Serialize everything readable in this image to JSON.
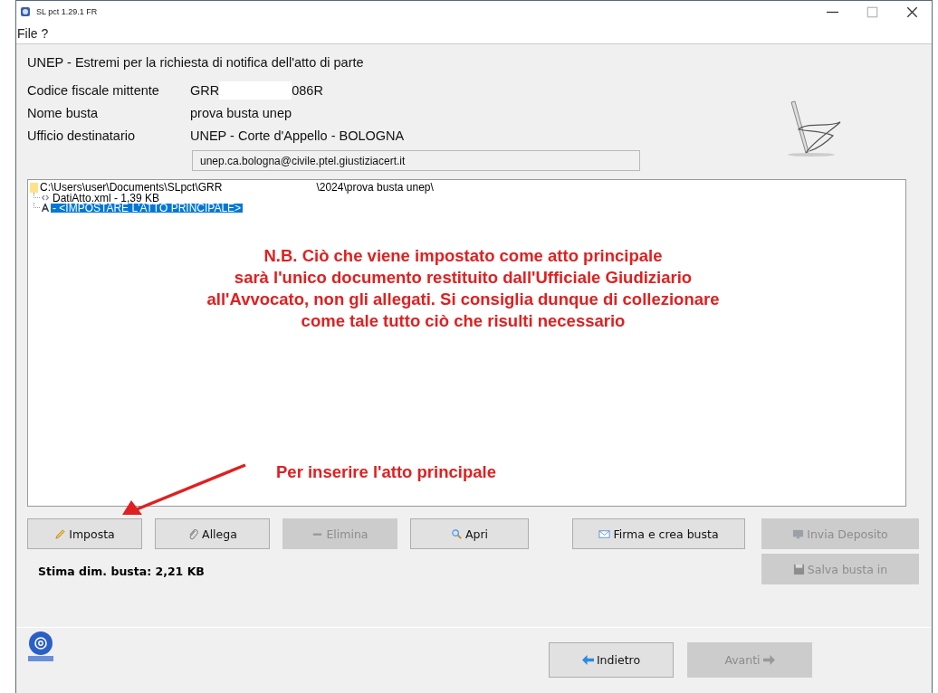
{
  "window": {
    "title": "SL pct 1.29.1 FR"
  },
  "menu": [
    "File",
    "?"
  ],
  "heading": "UNEP - Estremi per la richiesta di notifica dell'atto di parte",
  "fields": [
    {
      "label": "Codice fiscale mittente",
      "value_start": "GRR",
      "value_end": "086R"
    },
    {
      "label": "Nome busta",
      "value_start": "prova busta unep"
    },
    {
      "label": "Ufficio destinatario",
      "value_start": "UNEP - Corte d'Appello - BOLOGNA"
    }
  ],
  "email": {
    "value": "unep.ca.bologna@civile.ptel.giustiziacert.it"
  },
  "tree": {
    "label_start": "C:\\Users\\user\\Documents\\SLpct\\GRR",
    "label_end": "\\2024\\prova busta unep\\",
    "children": [
      {
        "kind": "xml",
        "label": "DatiAtto.xml - 1,39 KB",
        "selected": false
      },
      {
        "kind": "atto",
        "label": " - <IMPOSTARE L'ATTO PRINCIPALE>",
        "selected": true
      }
    ]
  },
  "note": [
    "N.B. Ciò che viene impostato come atto principale",
    "sarà l'unico documento restituito dall'Ufficiale Giudiziario",
    "all'Avvocato, non gli allegati. Si consiglia dunque di collezionare",
    "come tale tutto ciò che risulti necessario"
  ],
  "hint": "Per inserire l'atto principale",
  "buttons": [
    {
      "kind": "pencil",
      "label": "Imposta",
      "disabled": false
    },
    {
      "kind": "clip",
      "label": "Allega",
      "disabled": false
    },
    {
      "kind": "minus",
      "label": "Elimina",
      "disabled": true
    },
    {
      "kind": "search",
      "label": "Apri",
      "disabled": false
    },
    {
      "kind": "mail",
      "label": "Firma e crea busta",
      "disabled": false
    },
    {
      "kind": "send",
      "label": "Invia Deposito",
      "disabled": true
    },
    {
      "kind": "save",
      "label": "Salva busta in",
      "disabled": true
    }
  ],
  "size_estimate": "Stima dim. busta: 2,21 KB",
  "nav": [
    {
      "label": "Indietro",
      "kind": "back",
      "disabled": false
    },
    {
      "label": "Avanti",
      "kind": "forward",
      "disabled": true
    }
  ]
}
